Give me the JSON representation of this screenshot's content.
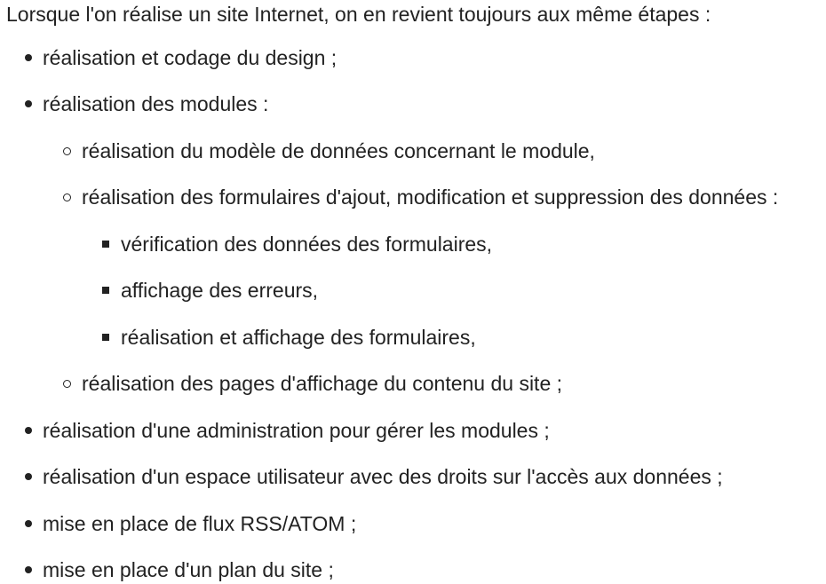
{
  "intro": "Lorsque l'on réalise un site Internet, on en revient toujours aux même étapes :",
  "steps": [
    "réalisation et codage du design ;",
    "réalisation des modules :",
    "réalisation du modèle de données concernant le module,",
    "réalisation des formulaires d'ajout, modification et suppression des données :",
    "vérification des données des formulaires,",
    "affichage des erreurs,",
    "réalisation et affichage des formulaires,",
    "réalisation des pages d'affichage du contenu du site ;",
    "réalisation d'une administration pour gérer les modules ;",
    "réalisation d'un espace utilisateur avec des droits sur l'accès aux données ;",
    "mise en place de flux RSS/ATOM ;",
    "mise en place d'un plan du site ;"
  ]
}
